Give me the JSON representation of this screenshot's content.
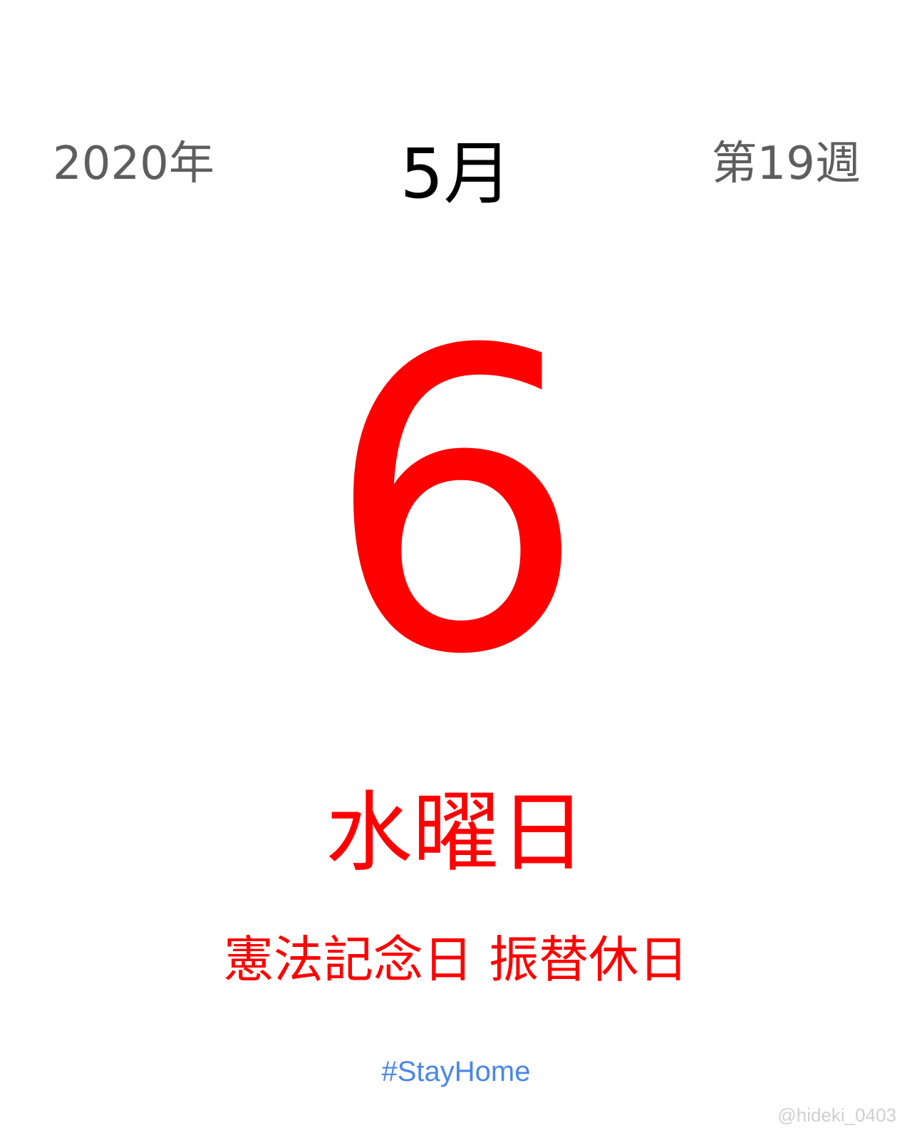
{
  "header": {
    "year": "2020年",
    "month": "5月",
    "week": "第19週"
  },
  "day": {
    "number": "6",
    "weekday": "水曜日",
    "holiday": "憲法記念日 振替休日"
  },
  "footer": {
    "hashtag": "#StayHome",
    "credit": "@hideki_0403"
  },
  "colors": {
    "holiday_red": "#ff0000",
    "header_gray": "#5e5e5e",
    "month_black": "#000000",
    "hashtag_blue": "#4a86e8",
    "credit_gray": "#d0d0d0",
    "background": "#ffffff"
  }
}
